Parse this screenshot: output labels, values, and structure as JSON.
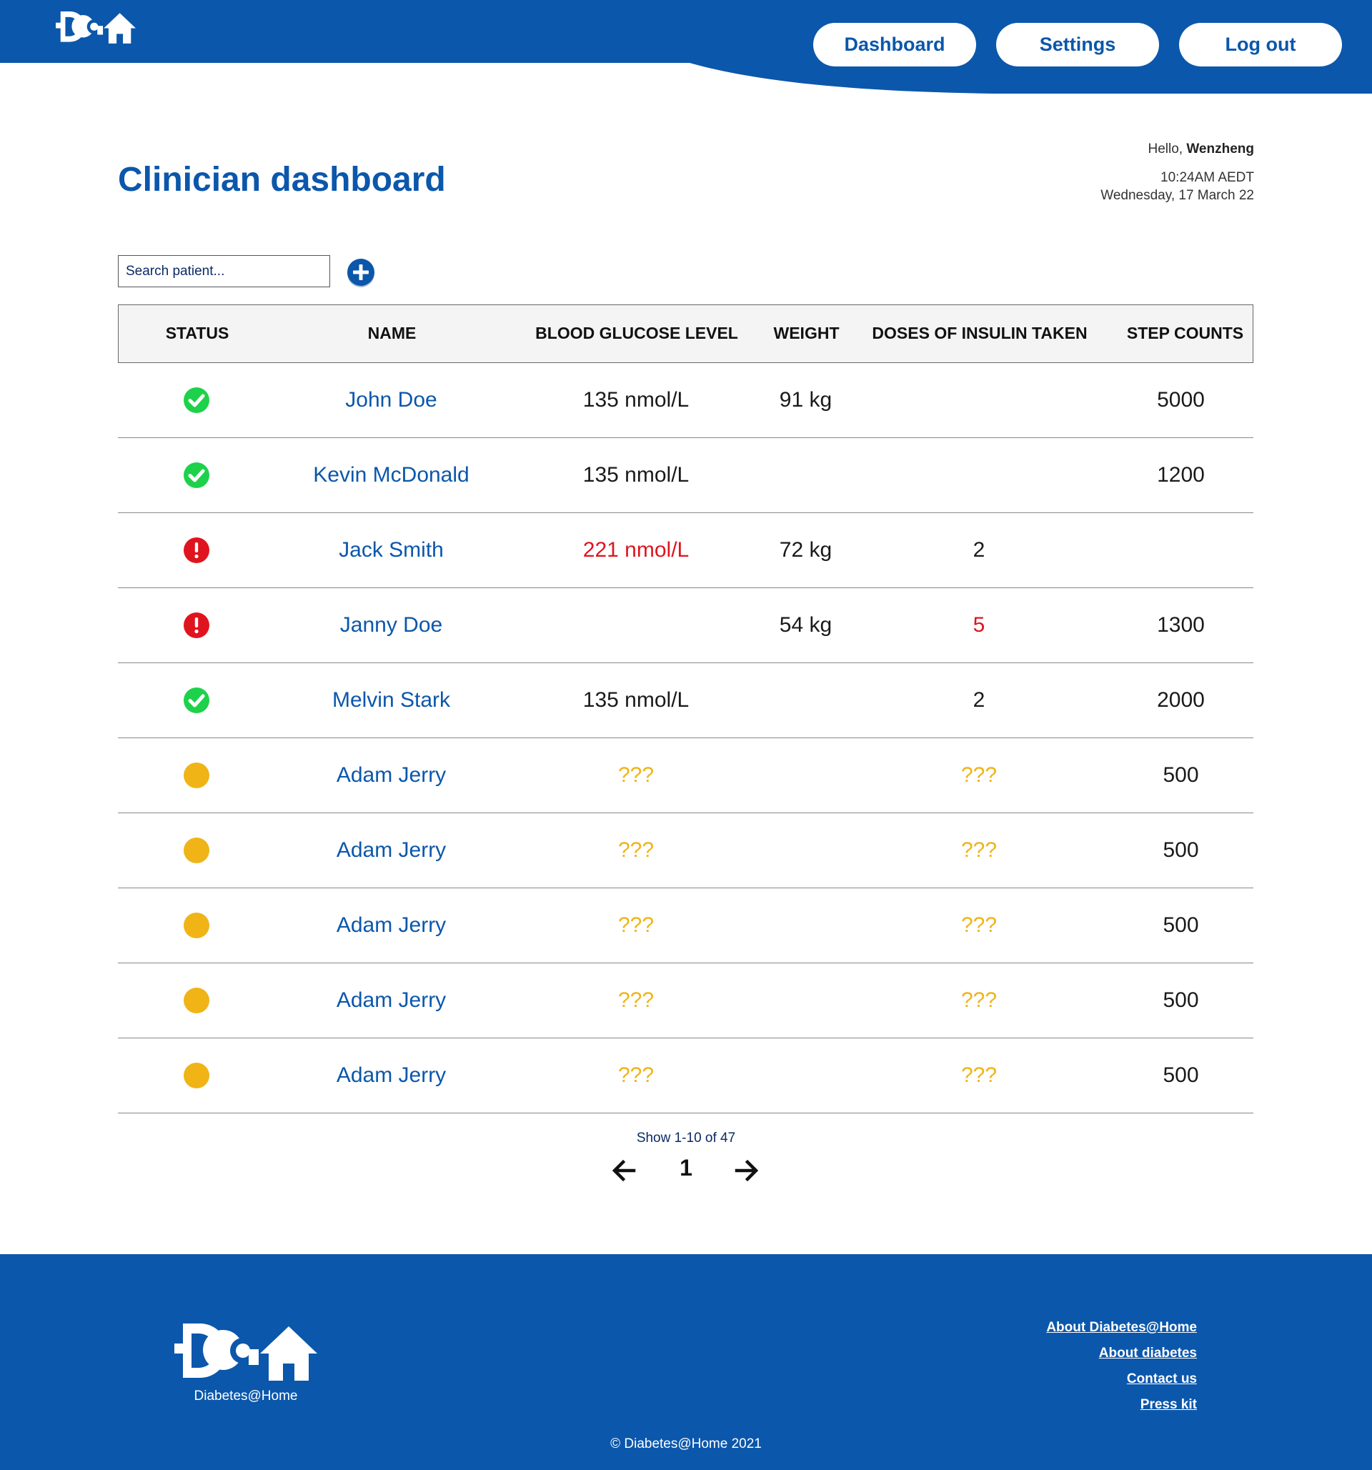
{
  "header": {
    "nav": {
      "dashboard": "Dashboard",
      "settings": "Settings",
      "logout": "Log out"
    }
  },
  "page": {
    "title": "Clinician dashboard",
    "greeting_prefix": "Hello, ",
    "user_name": "Wenzheng",
    "time": "10:24AM AEDT",
    "date": "Wednesday, 17 March 22"
  },
  "search": {
    "placeholder": "Search patient..."
  },
  "table": {
    "headers": {
      "status": "STATUS",
      "name": "NAME",
      "blood_glucose": "BLOOD GLUCOSE LEVEL",
      "weight": "WEIGHT",
      "insulin": "DOSES OF INSULIN TAKEN",
      "steps": "STEP COUNTS"
    },
    "rows": [
      {
        "status": "ok",
        "name": "John Doe",
        "bgl": "135 nmol/L",
        "bgl_state": "normal",
        "weight": "91 kg",
        "dose": "",
        "dose_state": "normal",
        "steps": "5000"
      },
      {
        "status": "ok",
        "name": "Kevin McDonald",
        "bgl": "135 nmol/L",
        "bgl_state": "normal",
        "weight": "",
        "dose": "",
        "dose_state": "normal",
        "steps": "1200"
      },
      {
        "status": "alert",
        "name": "Jack Smith",
        "bgl": "221 nmol/L",
        "bgl_state": "alert",
        "weight": "72 kg",
        "dose": "2",
        "dose_state": "normal",
        "steps": ""
      },
      {
        "status": "alert",
        "name": "Janny Doe",
        "bgl": "",
        "bgl_state": "normal",
        "weight": "54 kg",
        "dose": "5",
        "dose_state": "alert",
        "steps": "1300"
      },
      {
        "status": "ok",
        "name": "Melvin Stark",
        "bgl": "135 nmol/L",
        "bgl_state": "normal",
        "weight": "",
        "dose": "2",
        "dose_state": "normal",
        "steps": "2000"
      },
      {
        "status": "pending",
        "name": "Adam Jerry",
        "bgl": "???",
        "bgl_state": "pending",
        "weight": "",
        "dose": "???",
        "dose_state": "pending",
        "steps": "500"
      },
      {
        "status": "pending",
        "name": "Adam Jerry",
        "bgl": "???",
        "bgl_state": "pending",
        "weight": "",
        "dose": "???",
        "dose_state": "pending",
        "steps": "500"
      },
      {
        "status": "pending",
        "name": "Adam Jerry",
        "bgl": "???",
        "bgl_state": "pending",
        "weight": "",
        "dose": "???",
        "dose_state": "pending",
        "steps": "500"
      },
      {
        "status": "pending",
        "name": "Adam Jerry",
        "bgl": "???",
        "bgl_state": "pending",
        "weight": "",
        "dose": "???",
        "dose_state": "pending",
        "steps": "500"
      },
      {
        "status": "pending",
        "name": "Adam Jerry",
        "bgl": "???",
        "bgl_state": "pending",
        "weight": "",
        "dose": "???",
        "dose_state": "pending",
        "steps": "500"
      }
    ]
  },
  "pagination": {
    "info": "Show 1-10 of 47",
    "current_page": "1"
  },
  "footer": {
    "brand": "Diabetes@Home",
    "links": [
      "About Diabetes@Home",
      "About diabetes",
      "Contact us",
      "Press kit"
    ],
    "copyright": "© Diabetes@Home 2021"
  },
  "colors": {
    "primary": "#0b57ab",
    "ok": "#1ed14b",
    "alert": "#e0141e",
    "pending": "#f0b417"
  },
  "icons": {
    "ok": "check-circle-icon",
    "alert": "exclamation-circle-icon",
    "pending": "yellow-dot-icon",
    "add": "plus-circle-icon",
    "prev": "arrow-left-icon",
    "next": "arrow-right-icon"
  }
}
